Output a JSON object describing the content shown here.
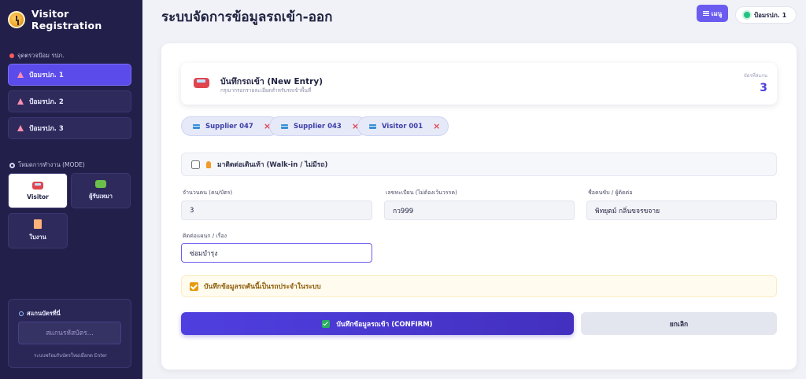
{
  "sidebar": {
    "brand_title": "Visitor Registration",
    "checkpoint_section_label": "จุดตรวจป้อม รปภ.",
    "checkpoints": [
      {
        "label": "ป้อมรปภ. 1",
        "active": true
      },
      {
        "label": "ป้อมรปภ. 2",
        "active": false
      },
      {
        "label": "ป้อมรปภ. 3",
        "active": false
      }
    ],
    "mode_section_label": "โหมดการทำงาน (MODE)",
    "modes": [
      {
        "label": "Visitor",
        "icon": "car-icon",
        "active": true
      },
      {
        "label": "ผู้รับเหมา",
        "icon": "truck-icon",
        "active": false
      },
      {
        "label": "ใบงาน",
        "icon": "document-icon",
        "active": false
      }
    ],
    "scan": {
      "title": "สแกนบัตรที่นี่",
      "placeholder": "สแกนรหัสบัตร...",
      "hint": "ระบบพร้อมรับบัตรใหม่เมื่อกด Enter"
    }
  },
  "header": {
    "title": "ระบบจัดการข้อมูลรถเข้า-ออก",
    "menu_label": "เมนู",
    "checkpoint_pill": "ป้อมรปภ. 1",
    "status_color": "#26c281"
  },
  "entry": {
    "title": "บันทึกรถเข้า (New Entry)",
    "subtitle": "กรุณากรอกรายละเอียดสำหรับรถเข้าพื้นที่",
    "count_label": "บัตรที่สแกน",
    "count_value": "3",
    "cards": [
      "Supplier 047",
      "Supplier 043",
      "Visitor 001"
    ],
    "walkin_label": "มาติดต่อเดินเท้า (Walk-in / ไม่มีรถ)",
    "walkin_checked": false
  },
  "form": {
    "people_label": "จำนวนคน (คน/บัตร)",
    "people_value": "3",
    "plate_label": "เลขทะเบียน (ไม่ต้องเว้นวรรค)",
    "plate_value": "กว999",
    "contact_label": "ชื่อคนขับ / ผู้ติดต่อ",
    "contact_value": "พิทยุตม์ กลิ่นขจรขจาย",
    "department_label": "ติดต่อแผนก / เรื่อง",
    "department_value": "ซ่อมบำรุง",
    "regular_label": "บันทึกข้อมูลรถคันนี้เป็นรถประจำในระบบ",
    "regular_checked": true
  },
  "actions": {
    "confirm_label": "บันทึกข้อมูลรถเข้า (CONFIRM)",
    "cancel_label": "ยกเลิก"
  },
  "colors": {
    "sidebar_bg": "#221f4a",
    "accent": "#5b4bea",
    "danger": "#e0454f",
    "warning": "#e69a0c"
  }
}
